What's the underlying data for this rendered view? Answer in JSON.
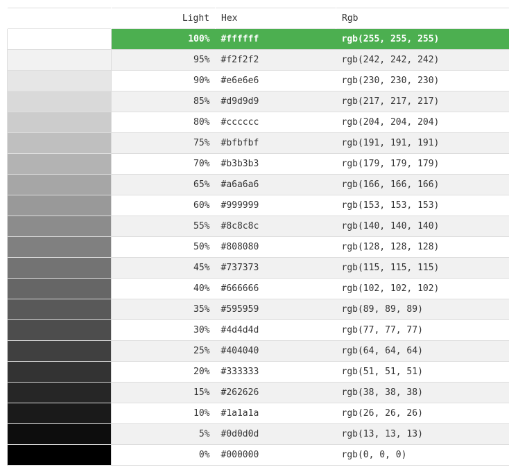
{
  "headers": {
    "light": "Light",
    "hex": "Hex",
    "rgb": "Rgb"
  },
  "rows": [
    {
      "light": "100%",
      "hex": "#ffffff",
      "rgb": "rgb(255, 255, 255)",
      "swatch": "#ffffff"
    },
    {
      "light": "95%",
      "hex": "#f2f2f2",
      "rgb": "rgb(242, 242, 242)",
      "swatch": "#f2f2f2"
    },
    {
      "light": "90%",
      "hex": "#e6e6e6",
      "rgb": "rgb(230, 230, 230)",
      "swatch": "#e6e6e6"
    },
    {
      "light": "85%",
      "hex": "#d9d9d9",
      "rgb": "rgb(217, 217, 217)",
      "swatch": "#d9d9d9"
    },
    {
      "light": "80%",
      "hex": "#cccccc",
      "rgb": "rgb(204, 204, 204)",
      "swatch": "#cccccc"
    },
    {
      "light": "75%",
      "hex": "#bfbfbf",
      "rgb": "rgb(191, 191, 191)",
      "swatch": "#bfbfbf"
    },
    {
      "light": "70%",
      "hex": "#b3b3b3",
      "rgb": "rgb(179, 179, 179)",
      "swatch": "#b3b3b3"
    },
    {
      "light": "65%",
      "hex": "#a6a6a6",
      "rgb": "rgb(166, 166, 166)",
      "swatch": "#a6a6a6"
    },
    {
      "light": "60%",
      "hex": "#999999",
      "rgb": "rgb(153, 153, 153)",
      "swatch": "#999999"
    },
    {
      "light": "55%",
      "hex": "#8c8c8c",
      "rgb": "rgb(140, 140, 140)",
      "swatch": "#8c8c8c"
    },
    {
      "light": "50%",
      "hex": "#808080",
      "rgb": "rgb(128, 128, 128)",
      "swatch": "#808080"
    },
    {
      "light": "45%",
      "hex": "#737373",
      "rgb": "rgb(115, 115, 115)",
      "swatch": "#737373"
    },
    {
      "light": "40%",
      "hex": "#666666",
      "rgb": "rgb(102, 102, 102)",
      "swatch": "#666666"
    },
    {
      "light": "35%",
      "hex": "#595959",
      "rgb": "rgb(89, 89, 89)",
      "swatch": "#595959"
    },
    {
      "light": "30%",
      "hex": "#4d4d4d",
      "rgb": "rgb(77, 77, 77)",
      "swatch": "#4d4d4d"
    },
    {
      "light": "25%",
      "hex": "#404040",
      "rgb": "rgb(64, 64, 64)",
      "swatch": "#404040"
    },
    {
      "light": "20%",
      "hex": "#333333",
      "rgb": "rgb(51, 51, 51)",
      "swatch": "#333333"
    },
    {
      "light": "15%",
      "hex": "#262626",
      "rgb": "rgb(38, 38, 38)",
      "swatch": "#262626"
    },
    {
      "light": "10%",
      "hex": "#1a1a1a",
      "rgb": "rgb(26, 26, 26)",
      "swatch": "#1a1a1a"
    },
    {
      "light": "5%",
      "hex": "#0d0d0d",
      "rgb": "rgb(13, 13, 13)",
      "swatch": "#0d0d0d"
    },
    {
      "light": "0%",
      "hex": "#000000",
      "rgb": "rgb(0, 0, 0)",
      "swatch": "#000000"
    }
  ],
  "selected_index": 0,
  "colors": {
    "selected_bg": "#4caf50",
    "alt_row_bg": "#f1f1f1",
    "border": "#dddddd"
  }
}
